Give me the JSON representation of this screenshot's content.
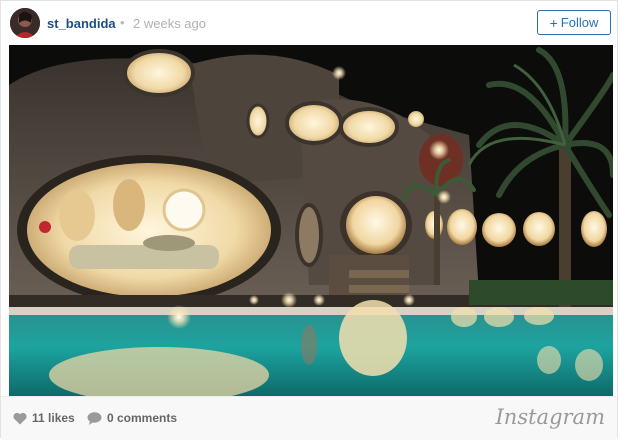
{
  "post": {
    "username": "st_bandida",
    "separator": "•",
    "time_ago": "2 weeks ago",
    "follow_label": "Follow"
  },
  "footer": {
    "likes": "11 likes",
    "comments": "0 comments",
    "brand": "Instagram"
  },
  "colors": {
    "link": "#1d4f86",
    "follow": "#2b6fb3",
    "pool": "#1f9b9a",
    "glow": "#f3e0b2"
  },
  "icons": {
    "follow": "plus-icon",
    "likes": "heart-icon",
    "comments": "speech-bubble-icon"
  }
}
